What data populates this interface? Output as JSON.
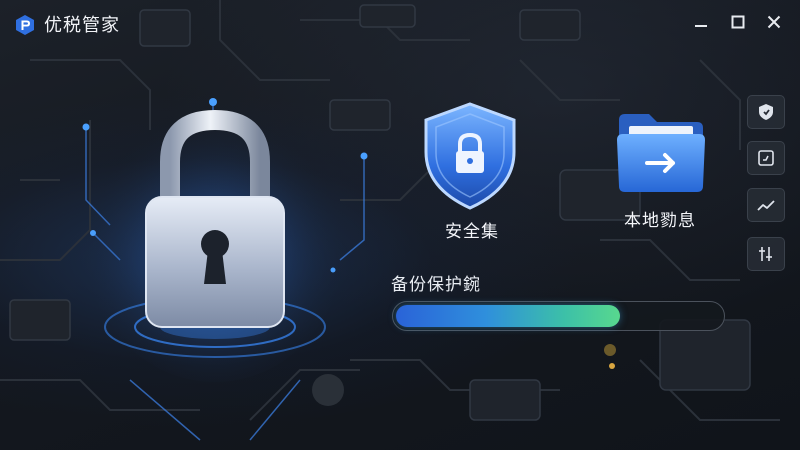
{
  "app": {
    "title": "优税管家",
    "logo_icon": "app-logo-icon",
    "accent": "#2f6fe0"
  },
  "window_controls": [
    "minimize-icon",
    "maximize-icon",
    "close-icon"
  ],
  "features": [
    {
      "label": "安全集",
      "icon": "shield-lock-icon"
    },
    {
      "label": "本地勠息",
      "icon": "folder-arrow-icon"
    }
  ],
  "progress": {
    "label": "备份保护鋺",
    "value_fraction": 0.69,
    "gradient_start": "#2a63d8",
    "gradient_end": "#58d88e"
  },
  "sidebar": [
    {
      "icon": "shield-icon"
    },
    {
      "icon": "chart-box-icon"
    },
    {
      "icon": "trend-line-icon"
    },
    {
      "icon": "sliders-icon"
    }
  ]
}
